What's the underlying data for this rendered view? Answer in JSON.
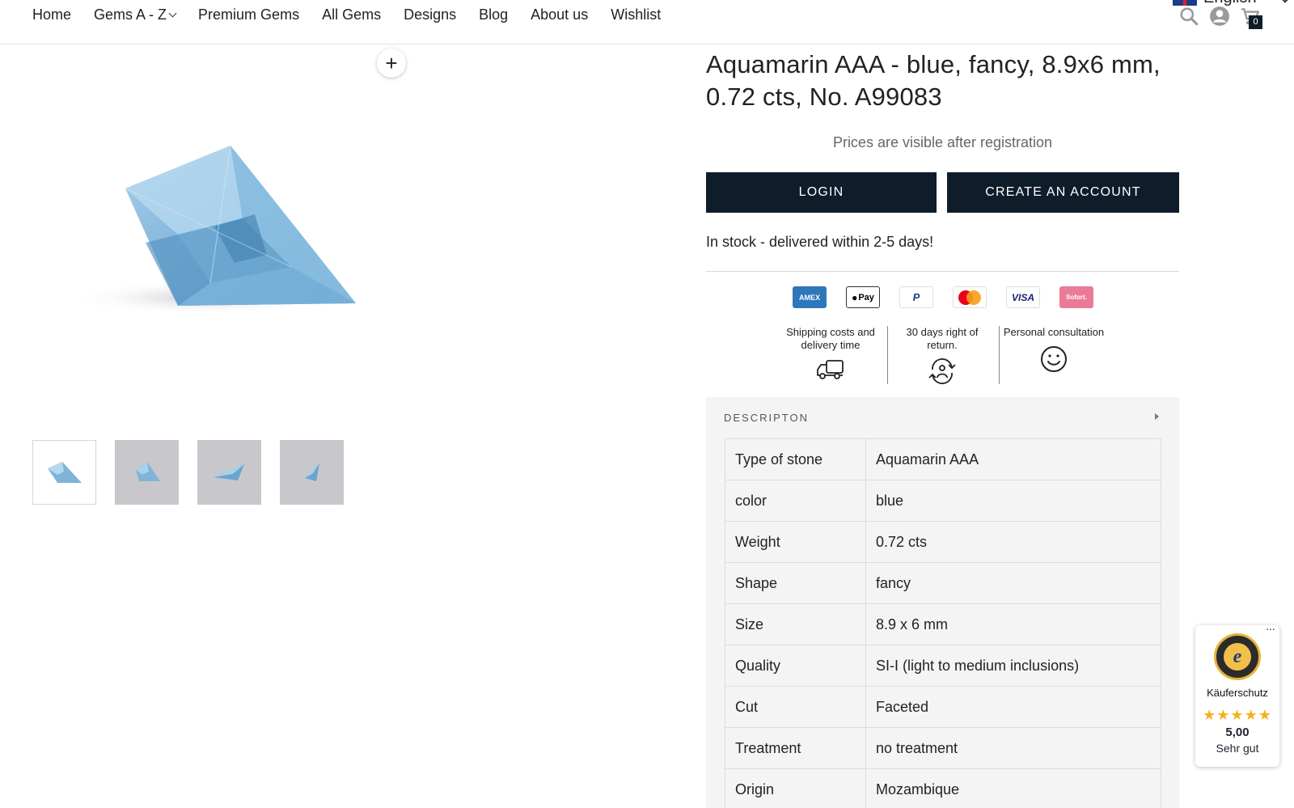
{
  "nav": {
    "items": [
      "Home",
      "Gems A - Z",
      "Premium Gems",
      "All Gems",
      "Designs",
      "Blog",
      "About us",
      "Wishlist"
    ],
    "language": "English",
    "cart_count": "0"
  },
  "gallery": {
    "zoom_label": "+",
    "thumbnail_count": 4,
    "gem_color": "#7fb3d8"
  },
  "product": {
    "title": "Aquamarin AAA - blue, fancy, 8.9x6 mm, 0.72 cts, No. A99083",
    "price_note": "Prices are visible after registration",
    "login_label": "LOGIN",
    "create_account_label": "CREATE AN ACCOUNT",
    "stock": "In stock - delivered within 2-5 days!",
    "accent_color": "#0f1d2b"
  },
  "payments": {
    "amex": "AMEX",
    "apple": "Pay",
    "paypal": "P",
    "visa": "VISA",
    "sofort": "Sofort."
  },
  "features": [
    {
      "label": "Shipping costs and delivery time",
      "icon": "truck-icon"
    },
    {
      "label": "30 days right of return.",
      "icon": "return-icon"
    },
    {
      "label": "Personal consultation",
      "icon": "smiley-icon"
    }
  ],
  "description": {
    "heading": "DESCRIPTON",
    "rows": [
      {
        "key": "Type of stone",
        "value": "Aquamarin AAA"
      },
      {
        "key": "color",
        "value": "blue"
      },
      {
        "key": "Weight",
        "value": "0.72 cts"
      },
      {
        "key": "Shape",
        "value": "fancy"
      },
      {
        "key": "Size",
        "value": "8.9 x 6 mm"
      },
      {
        "key": "Quality",
        "value": "SI-I (light to medium inclusions)"
      },
      {
        "key": "Cut",
        "value": "Faceted"
      },
      {
        "key": "Treatment",
        "value": "no treatment"
      },
      {
        "key": "Origin",
        "value": "Mozambique"
      }
    ]
  },
  "trusted_shops": {
    "dots": "···",
    "seal_letter": "e",
    "label": "Käuferschutz",
    "stars": "★★★★★",
    "score": "5,00",
    "grade": "Sehr gut"
  }
}
